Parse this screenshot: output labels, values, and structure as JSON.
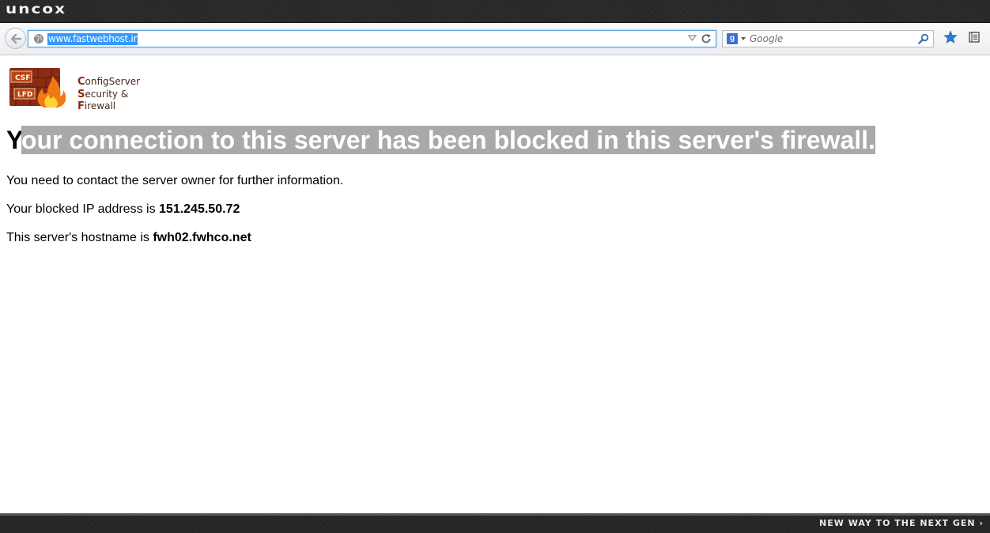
{
  "theme": {
    "brand": "uncox",
    "tagline": "NEW WAY TO THE NEXT GEN ›"
  },
  "toolbar": {
    "url": "www.fastwebhost.ir",
    "search_placeholder": "Google",
    "search_engine_letter": "g"
  },
  "logo": {
    "line1_cap": "C",
    "line1_rest": "onfigServer",
    "line2_cap": "S",
    "line2_rest": "ecurity &",
    "line3_cap": "F",
    "line3_rest": "irewall",
    "badge_top": "CSF",
    "badge_bottom": "LFD"
  },
  "page": {
    "headline_first": "Y",
    "headline_rest": "our connection to this server has been blocked in this server's firewall.",
    "contact_text": "You need to contact the server owner for further information.",
    "ip_label": "Your blocked IP address is ",
    "ip_value": "151.245.50.72",
    "hostname_label": "This server's hostname is ",
    "hostname_value": "fwh02.fwhco.net"
  },
  "colors": {
    "accent_selection": "#3399ff",
    "headline_selection": "#a9a9a9",
    "bar_dark": "#2a2a2a"
  }
}
